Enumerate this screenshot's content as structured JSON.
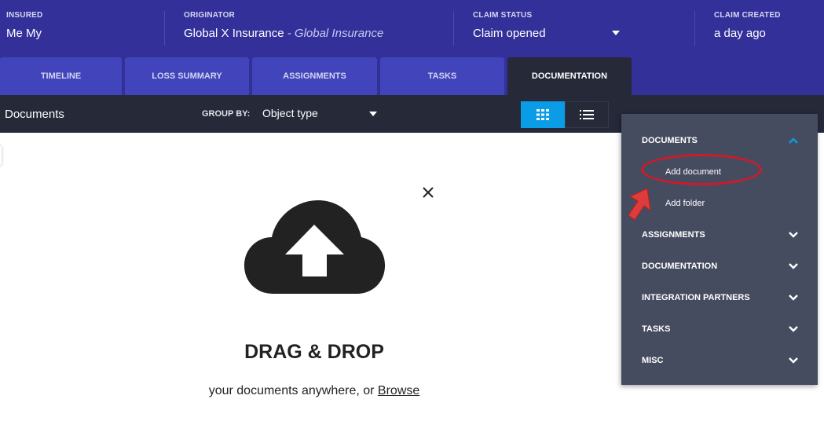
{
  "header": {
    "insured": {
      "label": "INSURED",
      "value": "Me My"
    },
    "originator": {
      "label": "ORIGINATOR",
      "value": "Global X Insurance",
      "value_alt": " - Global Insurance"
    },
    "claim_status": {
      "label": "CLAIM STATUS",
      "value": "Claim opened"
    },
    "claim_created": {
      "label": "CLAIM CREATED",
      "value": "a day ago"
    }
  },
  "tabs": [
    {
      "label": "TIMELINE"
    },
    {
      "label": "LOSS SUMMARY"
    },
    {
      "label": "ASSIGNMENTS"
    },
    {
      "label": "TASKS"
    },
    {
      "label": "DOCUMENTATION",
      "active": true
    }
  ],
  "toolbar": {
    "title": "Documents",
    "group_by_label": "GROUP BY:",
    "group_by_value": "Object type",
    "view_grid_icon": "grid-icon",
    "view_list_icon": "list-icon"
  },
  "dropzone": {
    "title": "DRAG & DROP",
    "subtitle": "your documents anywhere, or ",
    "browse_label": "Browse",
    "icon": "cloud-upload-icon"
  },
  "menu": {
    "sections": [
      {
        "label": "DOCUMENTS",
        "expanded": true,
        "items": [
          "Add document",
          "Add folder"
        ]
      },
      {
        "label": "ASSIGNMENTS",
        "expanded": false
      },
      {
        "label": "DOCUMENTATION",
        "expanded": false
      },
      {
        "label": "INTEGRATION PARTNERS",
        "expanded": false
      },
      {
        "label": "TASKS",
        "expanded": false
      },
      {
        "label": "MISC",
        "expanded": false
      }
    ]
  },
  "colors": {
    "header_bg": "#33309a",
    "tab_bg": "#4144ba",
    "toolbar_bg": "#252938",
    "accent": "#0b9ce8",
    "menu_bg": "#464c60",
    "annotation": "#d0192a"
  }
}
